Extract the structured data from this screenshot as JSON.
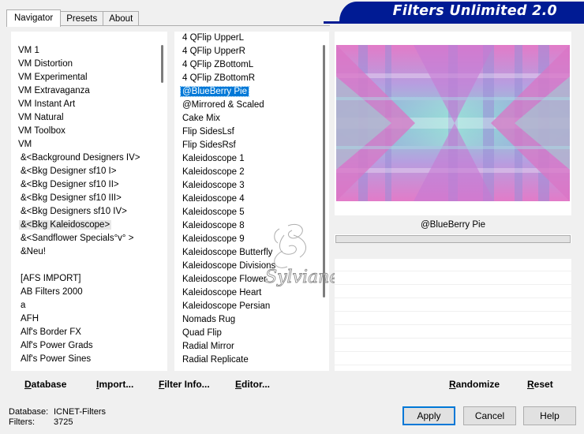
{
  "tabs": [
    "Navigator",
    "Presets",
    "About"
  ],
  "banner": {
    "title": "Filters Unlimited 2.0",
    "color": "#001b94"
  },
  "categories": {
    "items": [
      "VM 1",
      "VM Distortion",
      "VM Experimental",
      "VM Extravaganza",
      "VM Instant Art",
      "VM Natural",
      "VM Toolbox",
      "VM",
      "&<Background Designers IV>",
      "&<Bkg Designer sf10 I>",
      "&<Bkg Designer sf10 II>",
      "&<Bkg Designer sf10 III>",
      "&<Bkg Designers sf10 IV>",
      "&<Bkg Kaleidoscope>",
      "&<Sandflower Specials°v° >",
      "&Neu!",
      "",
      "[AFS IMPORT]",
      "AB Filters 2000",
      "a",
      "AFH",
      "Alf's Border FX",
      "Alf's Power Grads",
      "Alf's Power Sines"
    ],
    "focused_index": 13
  },
  "filters": {
    "items": [
      "4 QFlip UpperL",
      "4 QFlip UpperR",
      "4 QFlip ZBottomL",
      "4 QFlip ZBottomR",
      "@BlueBerry Pie",
      "@Mirrored & Scaled",
      "Cake Mix",
      "Flip SidesLsf",
      "Flip SidesRsf",
      "Kaleidoscope 1",
      "Kaleidoscope 2",
      "Kaleidoscope 3",
      "Kaleidoscope 4",
      "Kaleidoscope 5",
      "Kaleidoscope 8",
      "Kaleidoscope 9",
      "Kaleidoscope Butterfly",
      "Kaleidoscope Divisions",
      "Kaleidoscope Flower",
      "Kaleidoscope Heart",
      "Kaleidoscope Persian",
      "Nomads Rug",
      "Quad Flip",
      "Radial Mirror",
      "Radial Replicate"
    ],
    "selected_index": 4
  },
  "watermark": "Sylviane",
  "preview": {
    "selected_filter": "@BlueBerry Pie"
  },
  "buttons": {
    "database": "Database",
    "import": "Import...",
    "filter_info": "Filter Info...",
    "editor": "Editor...",
    "randomize": "Randomize",
    "reset": "Reset",
    "apply": "Apply",
    "cancel": "Cancel",
    "help": "Help"
  },
  "status": {
    "database_label": "Database:",
    "database_value": "ICNET-Filters",
    "filters_label": "Filters:",
    "filters_value": "3725"
  },
  "colors": {
    "selection": "#0078d7",
    "pink": "#e27bc8",
    "teal": "#8ad7d2",
    "blue": "#8c99dc"
  }
}
